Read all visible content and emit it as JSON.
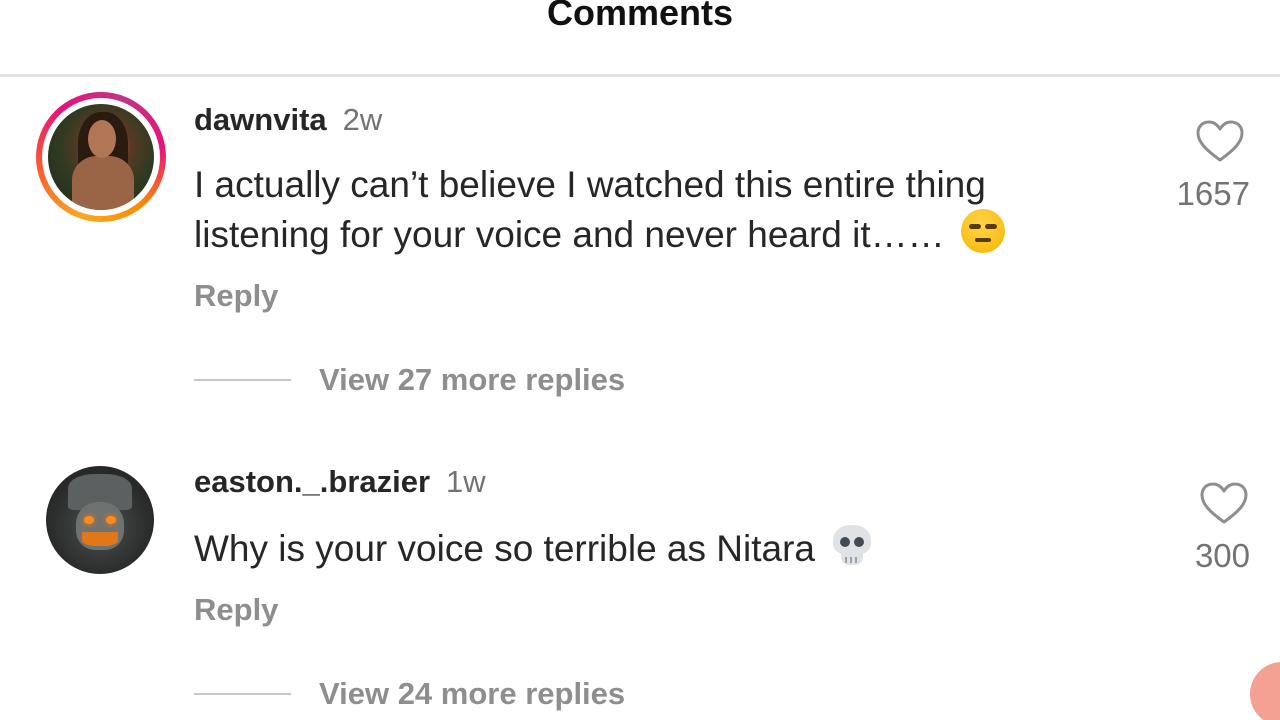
{
  "header": {
    "title": "Comments"
  },
  "comments": [
    {
      "username": "dawnvita",
      "timestamp": "2w",
      "text": "I actually can’t believe I watched this entire thing listening for your voice and never heard it……",
      "emoji": "unamused-face-emoji",
      "reply_label": "Reply",
      "view_replies_label": "View 27 more replies",
      "likes": "1657",
      "avatar_has_story_ring": true
    },
    {
      "username": "easton._.brazier",
      "timestamp": "1w",
      "text": "Why is your voice so terrible as Nitara",
      "emoji": "skull-emoji",
      "reply_label": "Reply",
      "view_replies_label": "View 24 more replies",
      "likes": "300",
      "avatar_has_story_ring": false
    }
  ],
  "icons": {
    "like": "heart-outline-icon"
  },
  "colors": {
    "text_primary": "#262626",
    "text_secondary": "#8e8e8e",
    "divider": "#e3e3e3",
    "story_ring_start": "#f9a825",
    "story_ring_end": "#e8117c"
  }
}
